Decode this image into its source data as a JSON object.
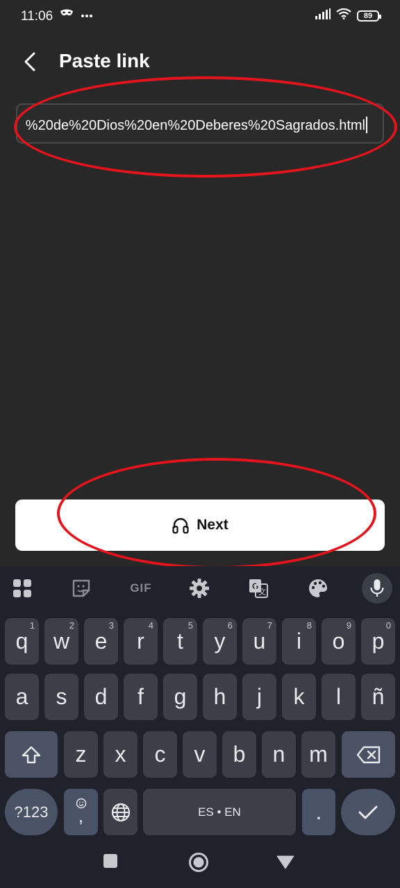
{
  "status_bar": {
    "time": "11:06",
    "battery": "89",
    "icons": [
      "mask-icon",
      "more-dots-icon",
      "signal-icon",
      "wifi-icon",
      "battery-icon"
    ]
  },
  "header": {
    "title": "Paste link",
    "back_icon": "chevron-left-icon"
  },
  "link_input": {
    "value": "%20de%20Dios%20en%20Deberes%20Sagrados.html"
  },
  "next_button": {
    "label": "Next",
    "icon": "headphones-icon"
  },
  "annotations": {
    "color": "#e3141c"
  },
  "keyboard": {
    "toolbar_icons": [
      "apps-grid-icon",
      "sticker-icon",
      "gif-icon",
      "settings-gear-icon",
      "translate-icon",
      "palette-icon",
      "microphone-icon"
    ],
    "gif_label": "GIF",
    "row1": [
      {
        "key": "q",
        "hint": "1"
      },
      {
        "key": "w",
        "hint": "2"
      },
      {
        "key": "e",
        "hint": "3"
      },
      {
        "key": "r",
        "hint": "4"
      },
      {
        "key": "t",
        "hint": "5"
      },
      {
        "key": "y",
        "hint": "6"
      },
      {
        "key": "u",
        "hint": "7"
      },
      {
        "key": "i",
        "hint": "8"
      },
      {
        "key": "o",
        "hint": "9"
      },
      {
        "key": "p",
        "hint": "0"
      }
    ],
    "row2": [
      "a",
      "s",
      "d",
      "f",
      "g",
      "h",
      "j",
      "k",
      "l",
      "ñ"
    ],
    "row3": [
      "z",
      "x",
      "c",
      "v",
      "b",
      "n",
      "m"
    ],
    "symbols_label": "?123",
    "comma_label": ",",
    "space_label": "ES • EN",
    "period_label": ".",
    "colors": {
      "background": "#1f222a",
      "key": "#3c3f47",
      "modifier_key": "#4a5366"
    }
  },
  "nav_bar": {
    "icons": [
      "recents-square-icon",
      "home-circle-icon",
      "back-triangle-icon"
    ]
  }
}
